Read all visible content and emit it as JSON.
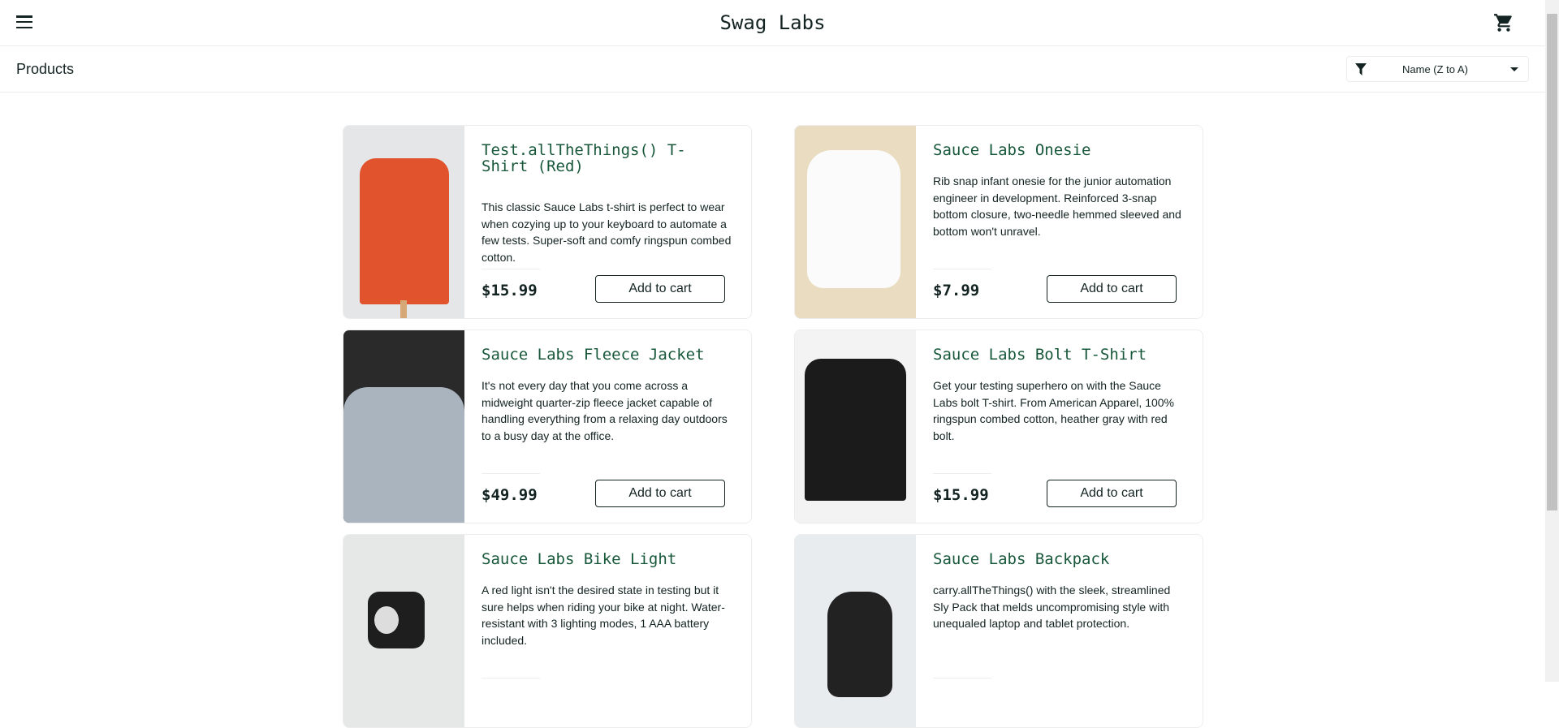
{
  "header": {
    "logo": "Swag Labs"
  },
  "subheader": {
    "title": "Products",
    "sort_selected": "Name (Z to A)"
  },
  "colors": {
    "title_green": "#18583a",
    "text": "#132322",
    "border": "#ededed"
  },
  "products": [
    {
      "name": "Test.allTheThings() T-Shirt (Red)",
      "description": "This classic Sauce Labs t-shirt is perfect to wear when cozying up to your keyboard to automate a few tests. Super-soft and comfy ringspun combed cotton.",
      "price": "$15.99",
      "button": "Add to cart"
    },
    {
      "name": "Sauce Labs Onesie",
      "description": "Rib snap infant onesie for the junior automation engineer in development. Reinforced 3-snap bottom closure, two-needle hemmed sleeved and bottom won't unravel.",
      "price": "$7.99",
      "button": "Add to cart"
    },
    {
      "name": "Sauce Labs Fleece Jacket",
      "description": "It's not every day that you come across a midweight quarter-zip fleece jacket capable of handling everything from a relaxing day outdoors to a busy day at the office.",
      "price": "$49.99",
      "button": "Add to cart"
    },
    {
      "name": "Sauce Labs Bolt T-Shirt",
      "description": "Get your testing superhero on with the Sauce Labs bolt T-shirt. From American Apparel, 100% ringspun combed cotton, heather gray with red bolt.",
      "price": "$15.99",
      "button": "Add to cart"
    },
    {
      "name": "Sauce Labs Bike Light",
      "description": "A red light isn't the desired state in testing but it sure helps when riding your bike at night. Water-resistant with 3 lighting modes, 1 AAA battery included.",
      "price": "",
      "button": ""
    },
    {
      "name": "Sauce Labs Backpack",
      "description": "carry.allTheThings() with the sleek, streamlined Sly Pack that melds uncompromising style with unequaled laptop and tablet protection.",
      "price": "",
      "button": ""
    }
  ]
}
